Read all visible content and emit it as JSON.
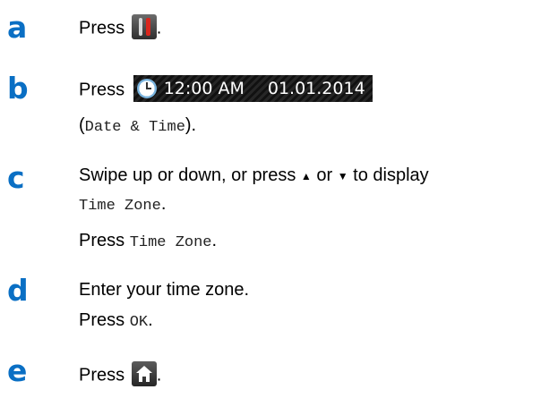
{
  "steps": {
    "a": {
      "letter": "a",
      "press": "Press",
      "end": "."
    },
    "b": {
      "letter": "b",
      "press": "Press",
      "time": "12:00 AM",
      "date": "01.01.2014",
      "paren_open": "(",
      "menu": "Date & Time",
      "paren_close": ")."
    },
    "c": {
      "letter": "c",
      "line1_text": "Swipe up or down, or press",
      "up_arrow": "▲",
      "or": "or",
      "down_arrow": "▼",
      "to_display": "to display",
      "option": "Time Zone",
      "option_end": ".",
      "press": "Press",
      "press_option": "Time Zone",
      "press_end": "."
    },
    "d": {
      "letter": "d",
      "text": "Enter your time zone.",
      "press": "Press",
      "ok": "OK",
      "ok_end": "."
    },
    "e": {
      "letter": "e",
      "press": "Press",
      "end": "."
    }
  },
  "icons": {
    "tools": "tools-icon",
    "clock": "clock-icon",
    "home": "home-icon"
  },
  "colors": {
    "step_letter": "#0a6fc4",
    "tool_red": "#d9261c",
    "clock_blue": "#7ab4de"
  }
}
